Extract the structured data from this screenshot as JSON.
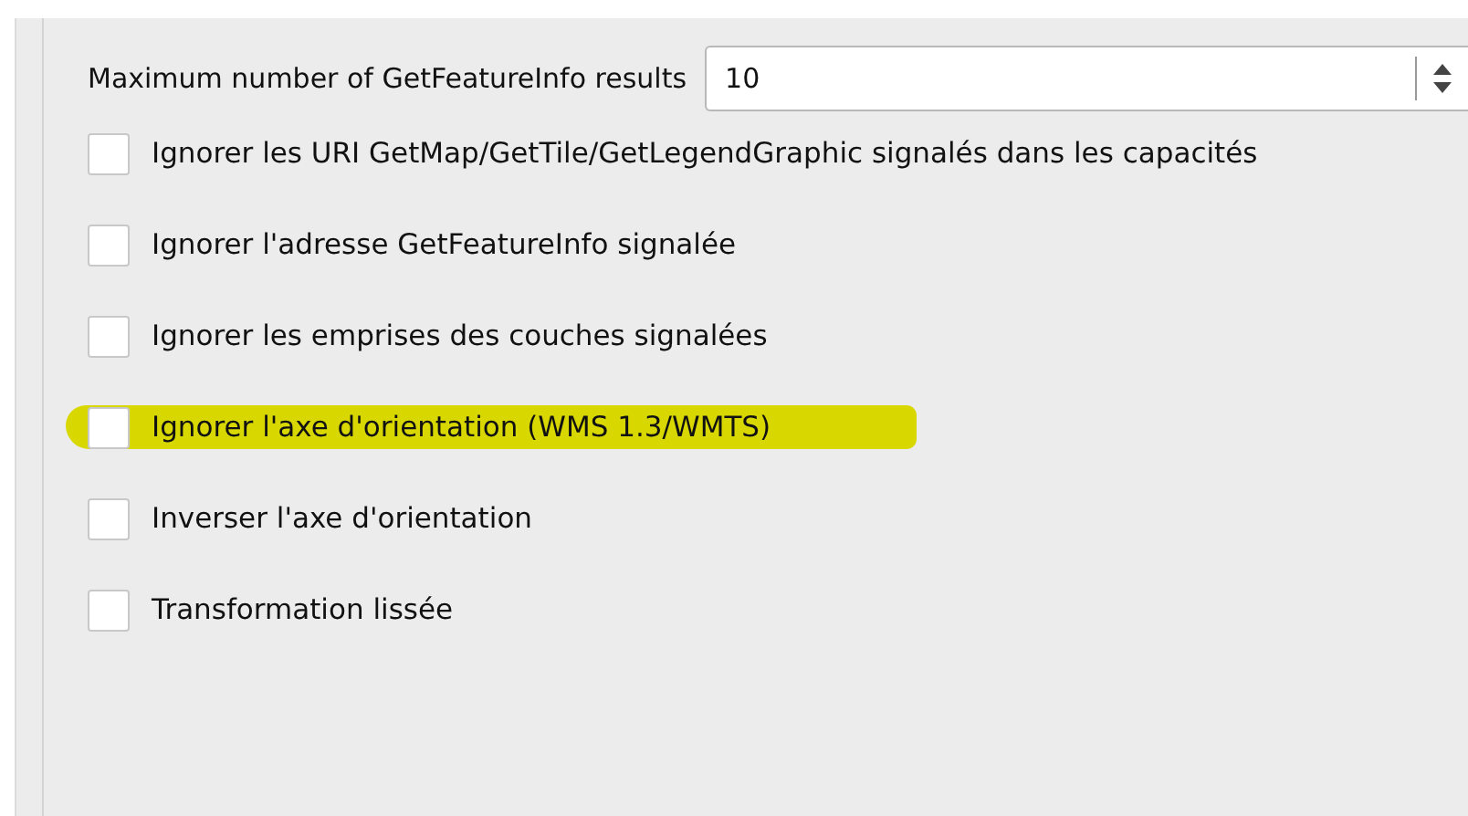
{
  "max_results": {
    "label": "Maximum number of GetFeatureInfo results",
    "value": "10"
  },
  "options": [
    {
      "label": "Ignorer les URI GetMap/GetTile/GetLegendGraphic signalés dans les capacités",
      "checked": false,
      "highlighted": false
    },
    {
      "label": "Ignorer l'adresse GetFeatureInfo signalée",
      "checked": false,
      "highlighted": false
    },
    {
      "label": "Ignorer les emprises des couches signalées",
      "checked": false,
      "highlighted": false
    },
    {
      "label": "Ignorer l'axe d'orientation (WMS 1.3/WMTS)",
      "checked": false,
      "highlighted": true
    },
    {
      "label": "Inverser l'axe d'orientation",
      "checked": false,
      "highlighted": false
    },
    {
      "label": "Transformation lissée",
      "checked": false,
      "highlighted": false
    }
  ]
}
